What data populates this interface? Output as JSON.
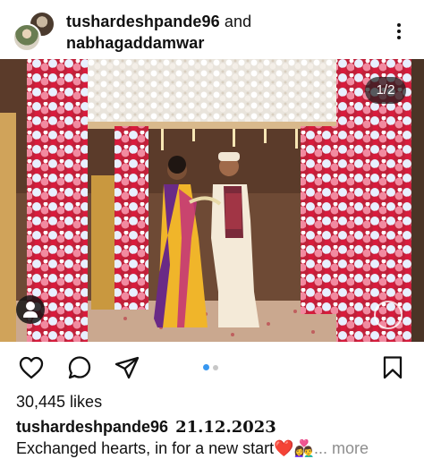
{
  "post": {
    "author_primary": "tushardeshpande96",
    "joiner": " and",
    "author_secondary": "nabhagaddamwar",
    "page_indicator": "1/2",
    "likes": "30,445 likes",
    "caption_author": "tushardeshpande96",
    "caption_date": "21.12.2023",
    "caption_text": "Exchanged hearts, in for a new start❤️👩‍❤️‍👨",
    "caption_more": "... more",
    "carousel": {
      "count": 2,
      "active": 0
    }
  },
  "icons": {
    "more": "more-vertical-icon",
    "like": "heart-icon",
    "comment": "comment-icon",
    "share": "send-icon",
    "save": "bookmark-icon",
    "tag": "user-tag-icon"
  },
  "colors": {
    "accent_blue": "#3897f0",
    "muted_text": "#8e8e8e",
    "text": "#111111"
  }
}
